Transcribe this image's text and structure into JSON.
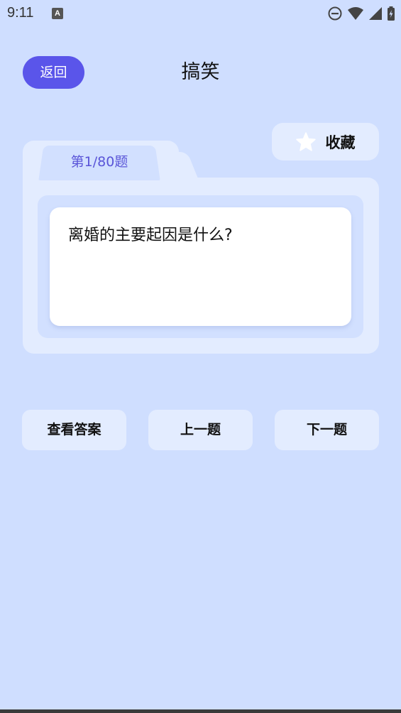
{
  "status_bar": {
    "time": "9:11",
    "app_icon_letter": "A"
  },
  "header": {
    "back_label": "返回",
    "title": "搞笑"
  },
  "favorite": {
    "label": "收藏",
    "icon": "star-icon"
  },
  "question": {
    "index_label": "第1/80题",
    "text": "离婚的主要起因是什么?"
  },
  "actions": {
    "show_answer": "查看答案",
    "previous": "上一题",
    "next": "下一题"
  },
  "colors": {
    "background": "#cfdeff",
    "accent": "#5a55ea",
    "card": "#e3ecff"
  }
}
